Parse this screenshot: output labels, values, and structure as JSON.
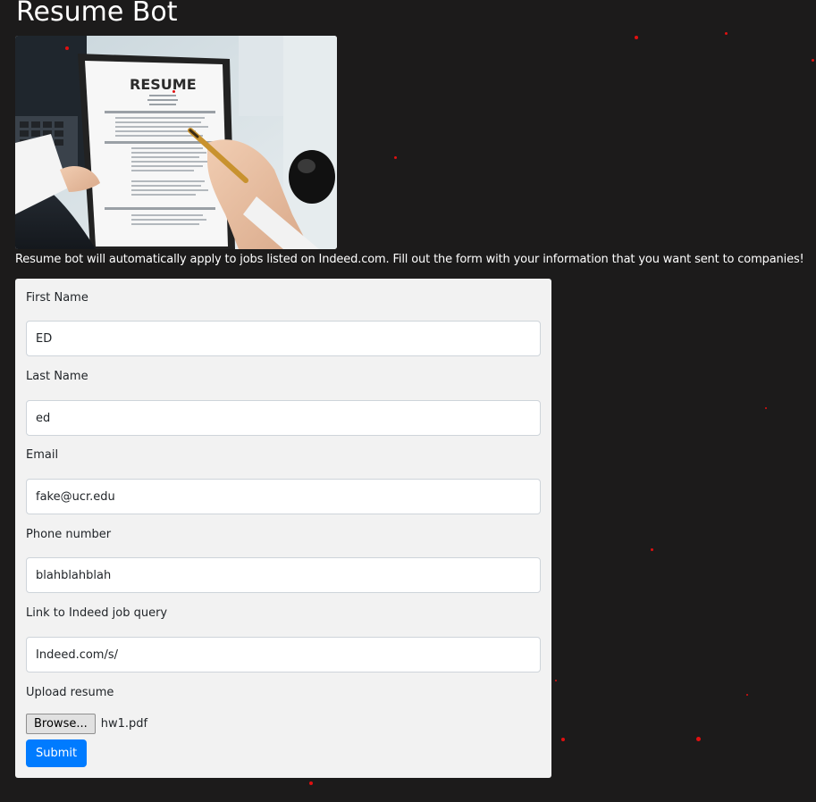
{
  "page": {
    "title": "Resume Bot",
    "intro": "Resume bot will automatically apply to jobs listed on Indeed.com. Fill out the form with your information that you want sent to companies!"
  },
  "hero_image": {
    "heading": "RESUME"
  },
  "form": {
    "first_name": {
      "label": "First Name",
      "value": "ED"
    },
    "last_name": {
      "label": "Last Name",
      "value": "ed"
    },
    "email": {
      "label": "Email",
      "value": "fake@ucr.edu"
    },
    "phone": {
      "label": "Phone number",
      "value": "blahblahblah"
    },
    "job_link": {
      "label": "Link to Indeed job query",
      "value": "Indeed.com/s/"
    },
    "resume": {
      "label": "Upload resume",
      "browse_label": "Browse...",
      "file_name": "hw1.pdf"
    },
    "submit_label": "Submit"
  },
  "colors": {
    "background": "#1c1b1b",
    "form_background": "#f2f2f2",
    "primary": "#007bff",
    "decor_dots": "#e01010"
  }
}
